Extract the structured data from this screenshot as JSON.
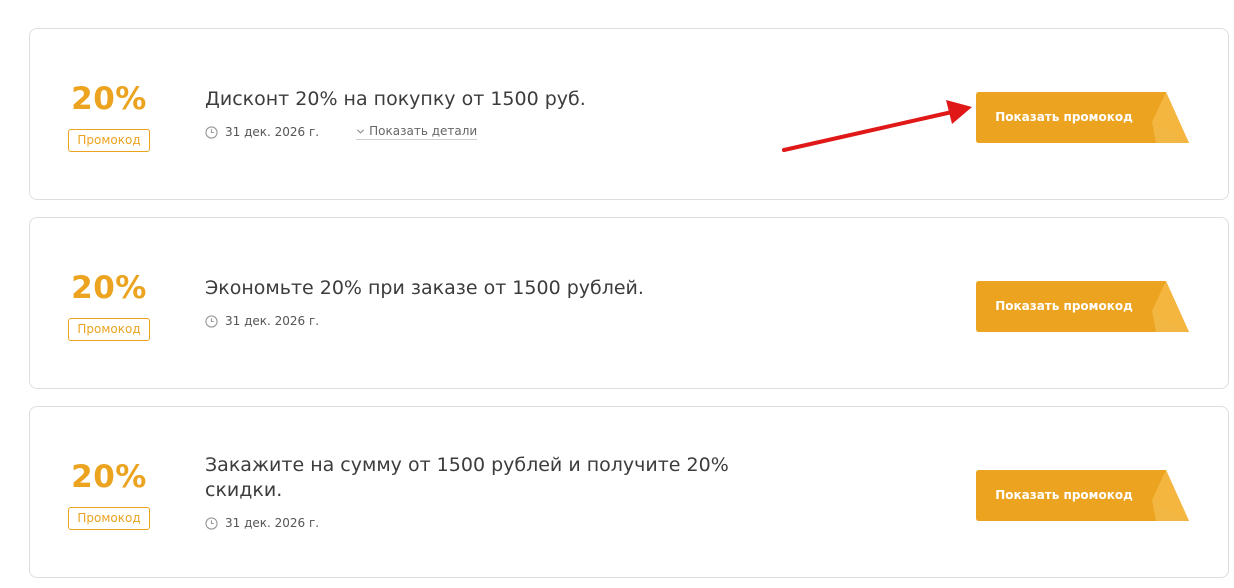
{
  "colors": {
    "accent": "#eba320",
    "accent_dark": "#f0b030",
    "arrow": "#e01818",
    "border": "#dedede"
  },
  "icons": {
    "date": "clock-icon",
    "details": "chevron-down-icon"
  },
  "coupons": [
    {
      "discount": "20%",
      "type_label": "Промокод",
      "title": "Дисконт 20% на покупку от 1500 руб.",
      "expiry": "31 дек. 2026 г.",
      "details_label": "Показать детали",
      "button_label": "Показать промокод"
    },
    {
      "discount": "20%",
      "type_label": "Промокод",
      "title": "Экономьте 20% при заказе от 1500 рублей.",
      "expiry": "31 дек. 2026 г.",
      "button_label": "Показать промокод"
    },
    {
      "discount": "20%",
      "type_label": "Промокод",
      "title": "Закажите на сумму от 1500 рублей и получите 20% скидки.",
      "expiry": "31 дек. 2026 г.",
      "button_label": "Показать промокод"
    }
  ]
}
